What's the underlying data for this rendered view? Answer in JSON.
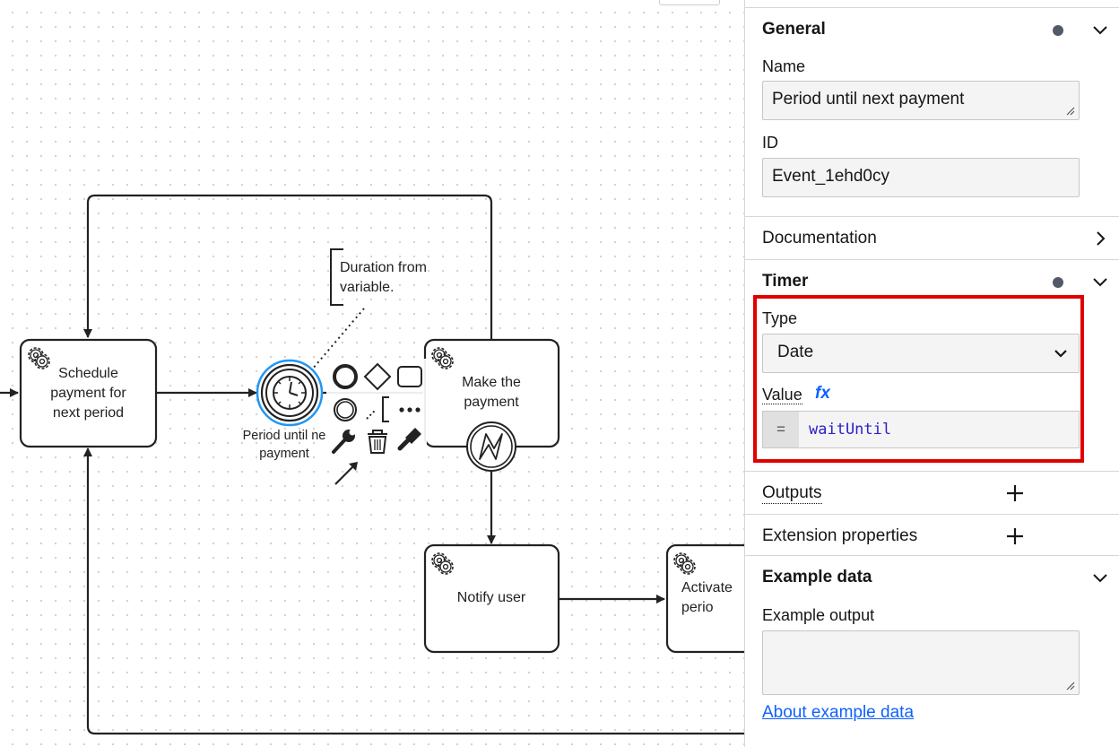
{
  "diagram": {
    "tasks": {
      "schedule": "Schedule payment for next period",
      "make_payment": "Make the payment",
      "notify": "Notify user",
      "activate": "Activate perio"
    },
    "timer_event_label": "Period until ne payment",
    "annotation": "Duration from variable."
  },
  "panel": {
    "general": {
      "title": "General",
      "name_label": "Name",
      "name_value": "Period until next payment",
      "id_label": "ID",
      "id_value": "Event_1ehd0cy"
    },
    "documentation": {
      "title": "Documentation"
    },
    "timer": {
      "title": "Timer",
      "type_label": "Type",
      "type_value": "Date",
      "value_label": "Value",
      "fx": "fx",
      "equals": "=",
      "value_expression": "waitUntil"
    },
    "outputs": {
      "title": "Outputs"
    },
    "extension_properties": {
      "title": "Extension properties"
    },
    "example_data": {
      "title": "Example data",
      "output_label": "Example output",
      "link": "About example data"
    }
  },
  "colors": {
    "selection": "#2196f3",
    "highlight_box": "#e00000",
    "link": "#0f62fe",
    "expression": "#2c20c8"
  }
}
